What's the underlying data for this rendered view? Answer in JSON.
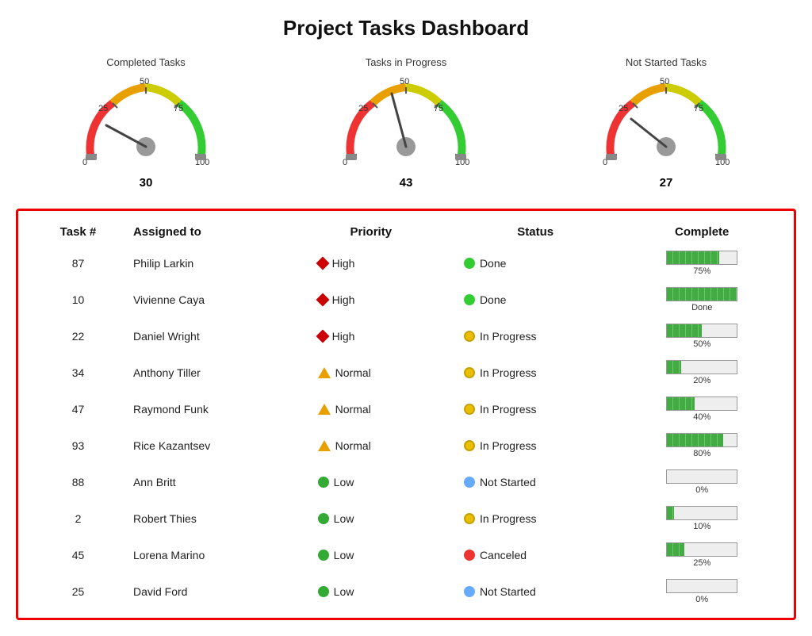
{
  "title": "Project Tasks Dashboard",
  "gauges": [
    {
      "label": "Completed Tasks",
      "value": 30,
      "max": 100
    },
    {
      "label": "Tasks in Progress",
      "value": 43,
      "max": 100
    },
    {
      "label": "Not Started Tasks",
      "value": 27,
      "max": 100
    }
  ],
  "table": {
    "headers": [
      "Task #",
      "Assigned to",
      "Priority",
      "Status",
      "Complete"
    ],
    "rows": [
      {
        "task": "87",
        "person": "Philip Larkin",
        "priority": "High",
        "priorityType": "diamond",
        "status": "Done",
        "statusType": "green",
        "pct": 75
      },
      {
        "task": "10",
        "person": "Vivienne Caya",
        "priority": "High",
        "priorityType": "diamond",
        "status": "Done",
        "statusType": "green",
        "pct": 100,
        "pctLabel": "Done"
      },
      {
        "task": "22",
        "person": "Daniel Wright",
        "priority": "High",
        "priorityType": "diamond",
        "status": "In Progress",
        "statusType": "yellow",
        "pct": 50
      },
      {
        "task": "34",
        "person": "Anthony Tiller",
        "priority": "Normal",
        "priorityType": "triangle",
        "status": "In Progress",
        "statusType": "yellow",
        "pct": 20
      },
      {
        "task": "47",
        "person": "Raymond Funk",
        "priority": "Normal",
        "priorityType": "triangle",
        "status": "In Progress",
        "statusType": "yellow",
        "pct": 40
      },
      {
        "task": "93",
        "person": "Rice Kazantsev",
        "priority": "Normal",
        "priorityType": "triangle",
        "status": "In Progress",
        "statusType": "yellow",
        "pct": 80
      },
      {
        "task": "88",
        "person": "Ann Britt",
        "priority": "Low",
        "priorityType": "circle",
        "status": "Not Started",
        "statusType": "blue",
        "pct": 0
      },
      {
        "task": "2",
        "person": "Robert Thies",
        "priority": "Low",
        "priorityType": "circle",
        "status": "In Progress",
        "statusType": "yellow",
        "pct": 10
      },
      {
        "task": "45",
        "person": "Lorena Marino",
        "priority": "Low",
        "priorityType": "circle",
        "status": "Canceled",
        "statusType": "red",
        "pct": 25
      },
      {
        "task": "25",
        "person": "David Ford",
        "priority": "Low",
        "priorityType": "circle",
        "status": "Not Started",
        "statusType": "blue",
        "pct": 0
      }
    ]
  }
}
